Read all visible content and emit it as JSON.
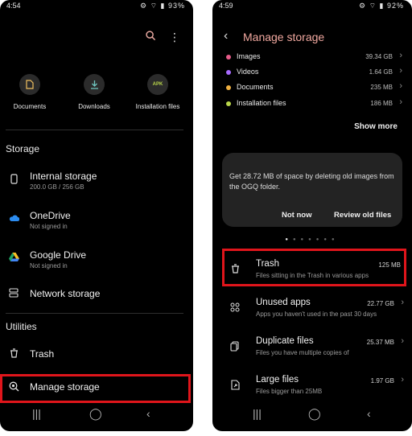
{
  "left": {
    "status": {
      "time": "4:54",
      "battery": "93%"
    },
    "quick_access": [
      {
        "label": "Documents",
        "icon": "document-icon"
      },
      {
        "label": "Downloads",
        "icon": "download-icon"
      },
      {
        "label": "Installation files",
        "icon": "apk-icon",
        "icon_text": "APK"
      }
    ],
    "storage_title": "Storage",
    "storage": [
      {
        "title": "Internal storage",
        "sub": "200.0 GB / 256 GB"
      },
      {
        "title": "OneDrive",
        "sub": "Not signed in"
      },
      {
        "title": "Google Drive",
        "sub": "Not signed in"
      },
      {
        "title": "Network storage"
      }
    ],
    "utilities_title": "Utilities",
    "utilities": [
      {
        "title": "Trash"
      },
      {
        "title": "Manage storage"
      }
    ]
  },
  "right": {
    "status": {
      "time": "4:59",
      "battery": "92%"
    },
    "title": "Manage storage",
    "categories": [
      {
        "name": "Images",
        "size": "39.34 GB",
        "color": "#e85c8a"
      },
      {
        "name": "Videos",
        "size": "1.64 GB",
        "color": "#a86bff"
      },
      {
        "name": "Documents",
        "size": "235 MB",
        "color": "#f0b040"
      },
      {
        "name": "Installation files",
        "size": "186 MB",
        "color": "#b9d64a"
      }
    ],
    "show_more": "Show more",
    "card": {
      "message": "Get 28.72 MB of space by deleting old images from the OGQ folder.",
      "not_now": "Not now",
      "review": "Review old files"
    },
    "items": [
      {
        "title": "Trash",
        "sub": "Files sitting in the Trash in various apps",
        "size": "125 MB"
      },
      {
        "title": "Unused apps",
        "sub": "Apps you haven't used in the past 30 days",
        "size": "22.77 GB"
      },
      {
        "title": "Duplicate files",
        "sub": "Files you have multiple copies of",
        "size": "25.37 MB"
      },
      {
        "title": "Large files",
        "sub": "Files bigger than 25MB",
        "size": "1.97 GB"
      }
    ]
  },
  "colors": {
    "highlight": "#e0151b",
    "accent_title": "#f2a9a0"
  }
}
